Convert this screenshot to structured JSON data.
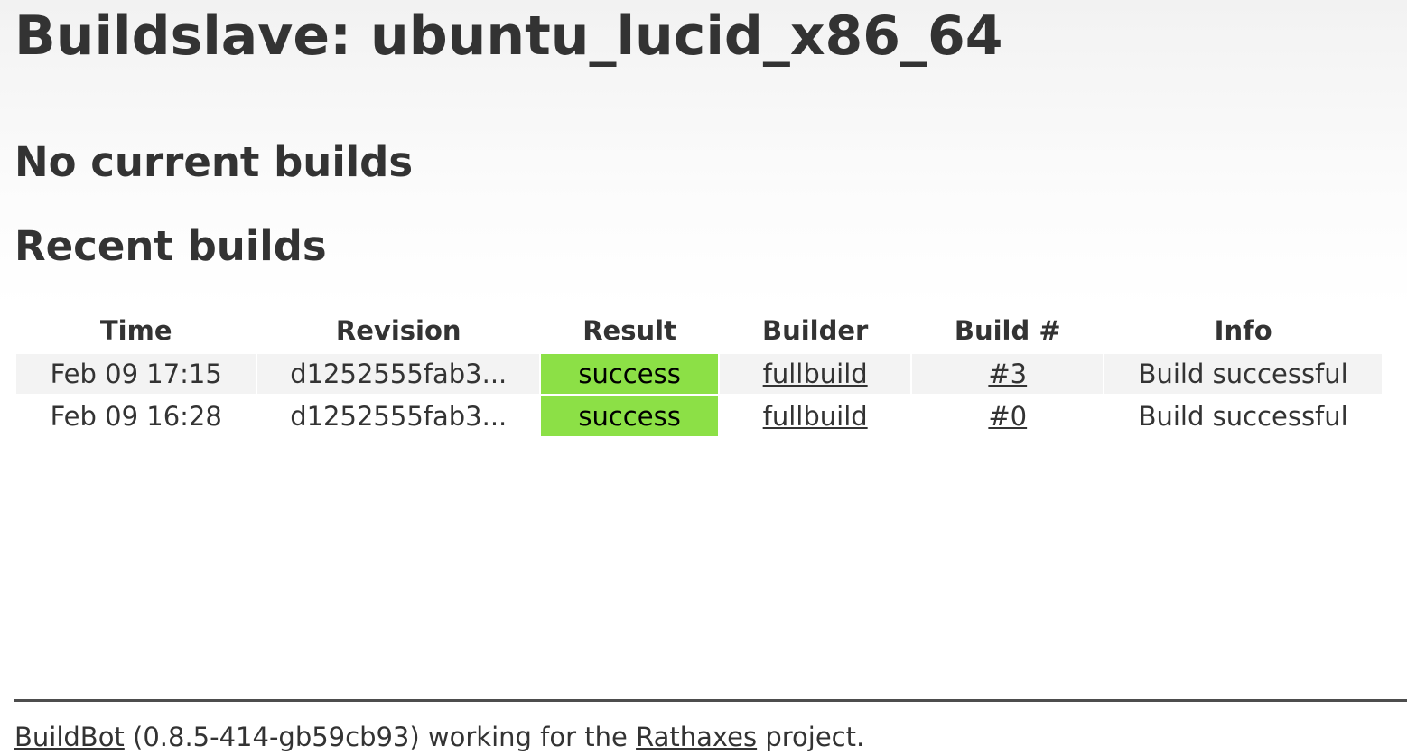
{
  "page": {
    "title": "Buildslave: ubuntu_lucid_x86_64"
  },
  "current_builds": {
    "heading": "No current builds"
  },
  "recent_builds": {
    "heading": "Recent builds",
    "columns": {
      "time": "Time",
      "revision": "Revision",
      "result": "Result",
      "builder": "Builder",
      "build_number": "Build #",
      "info": "Info"
    },
    "rows": [
      {
        "time": "Feb 09 17:15",
        "revision": "d1252555fab3...",
        "result": "success",
        "builder": "fullbuild",
        "build_number": "#3",
        "info": "Build successful"
      },
      {
        "time": "Feb 09 16:28",
        "revision": "d1252555fab3...",
        "result": "success",
        "builder": "fullbuild",
        "build_number": "#0",
        "info": "Build successful"
      }
    ]
  },
  "footer": {
    "buildbot_link": "BuildBot",
    "version": " (0.8.5-414-gb59cb93) working for the ",
    "project_link": "Rathaxes",
    "suffix": " project."
  },
  "colors": {
    "success": "#8ce046",
    "text": "#333333",
    "row_background": "#f3f3f3"
  }
}
